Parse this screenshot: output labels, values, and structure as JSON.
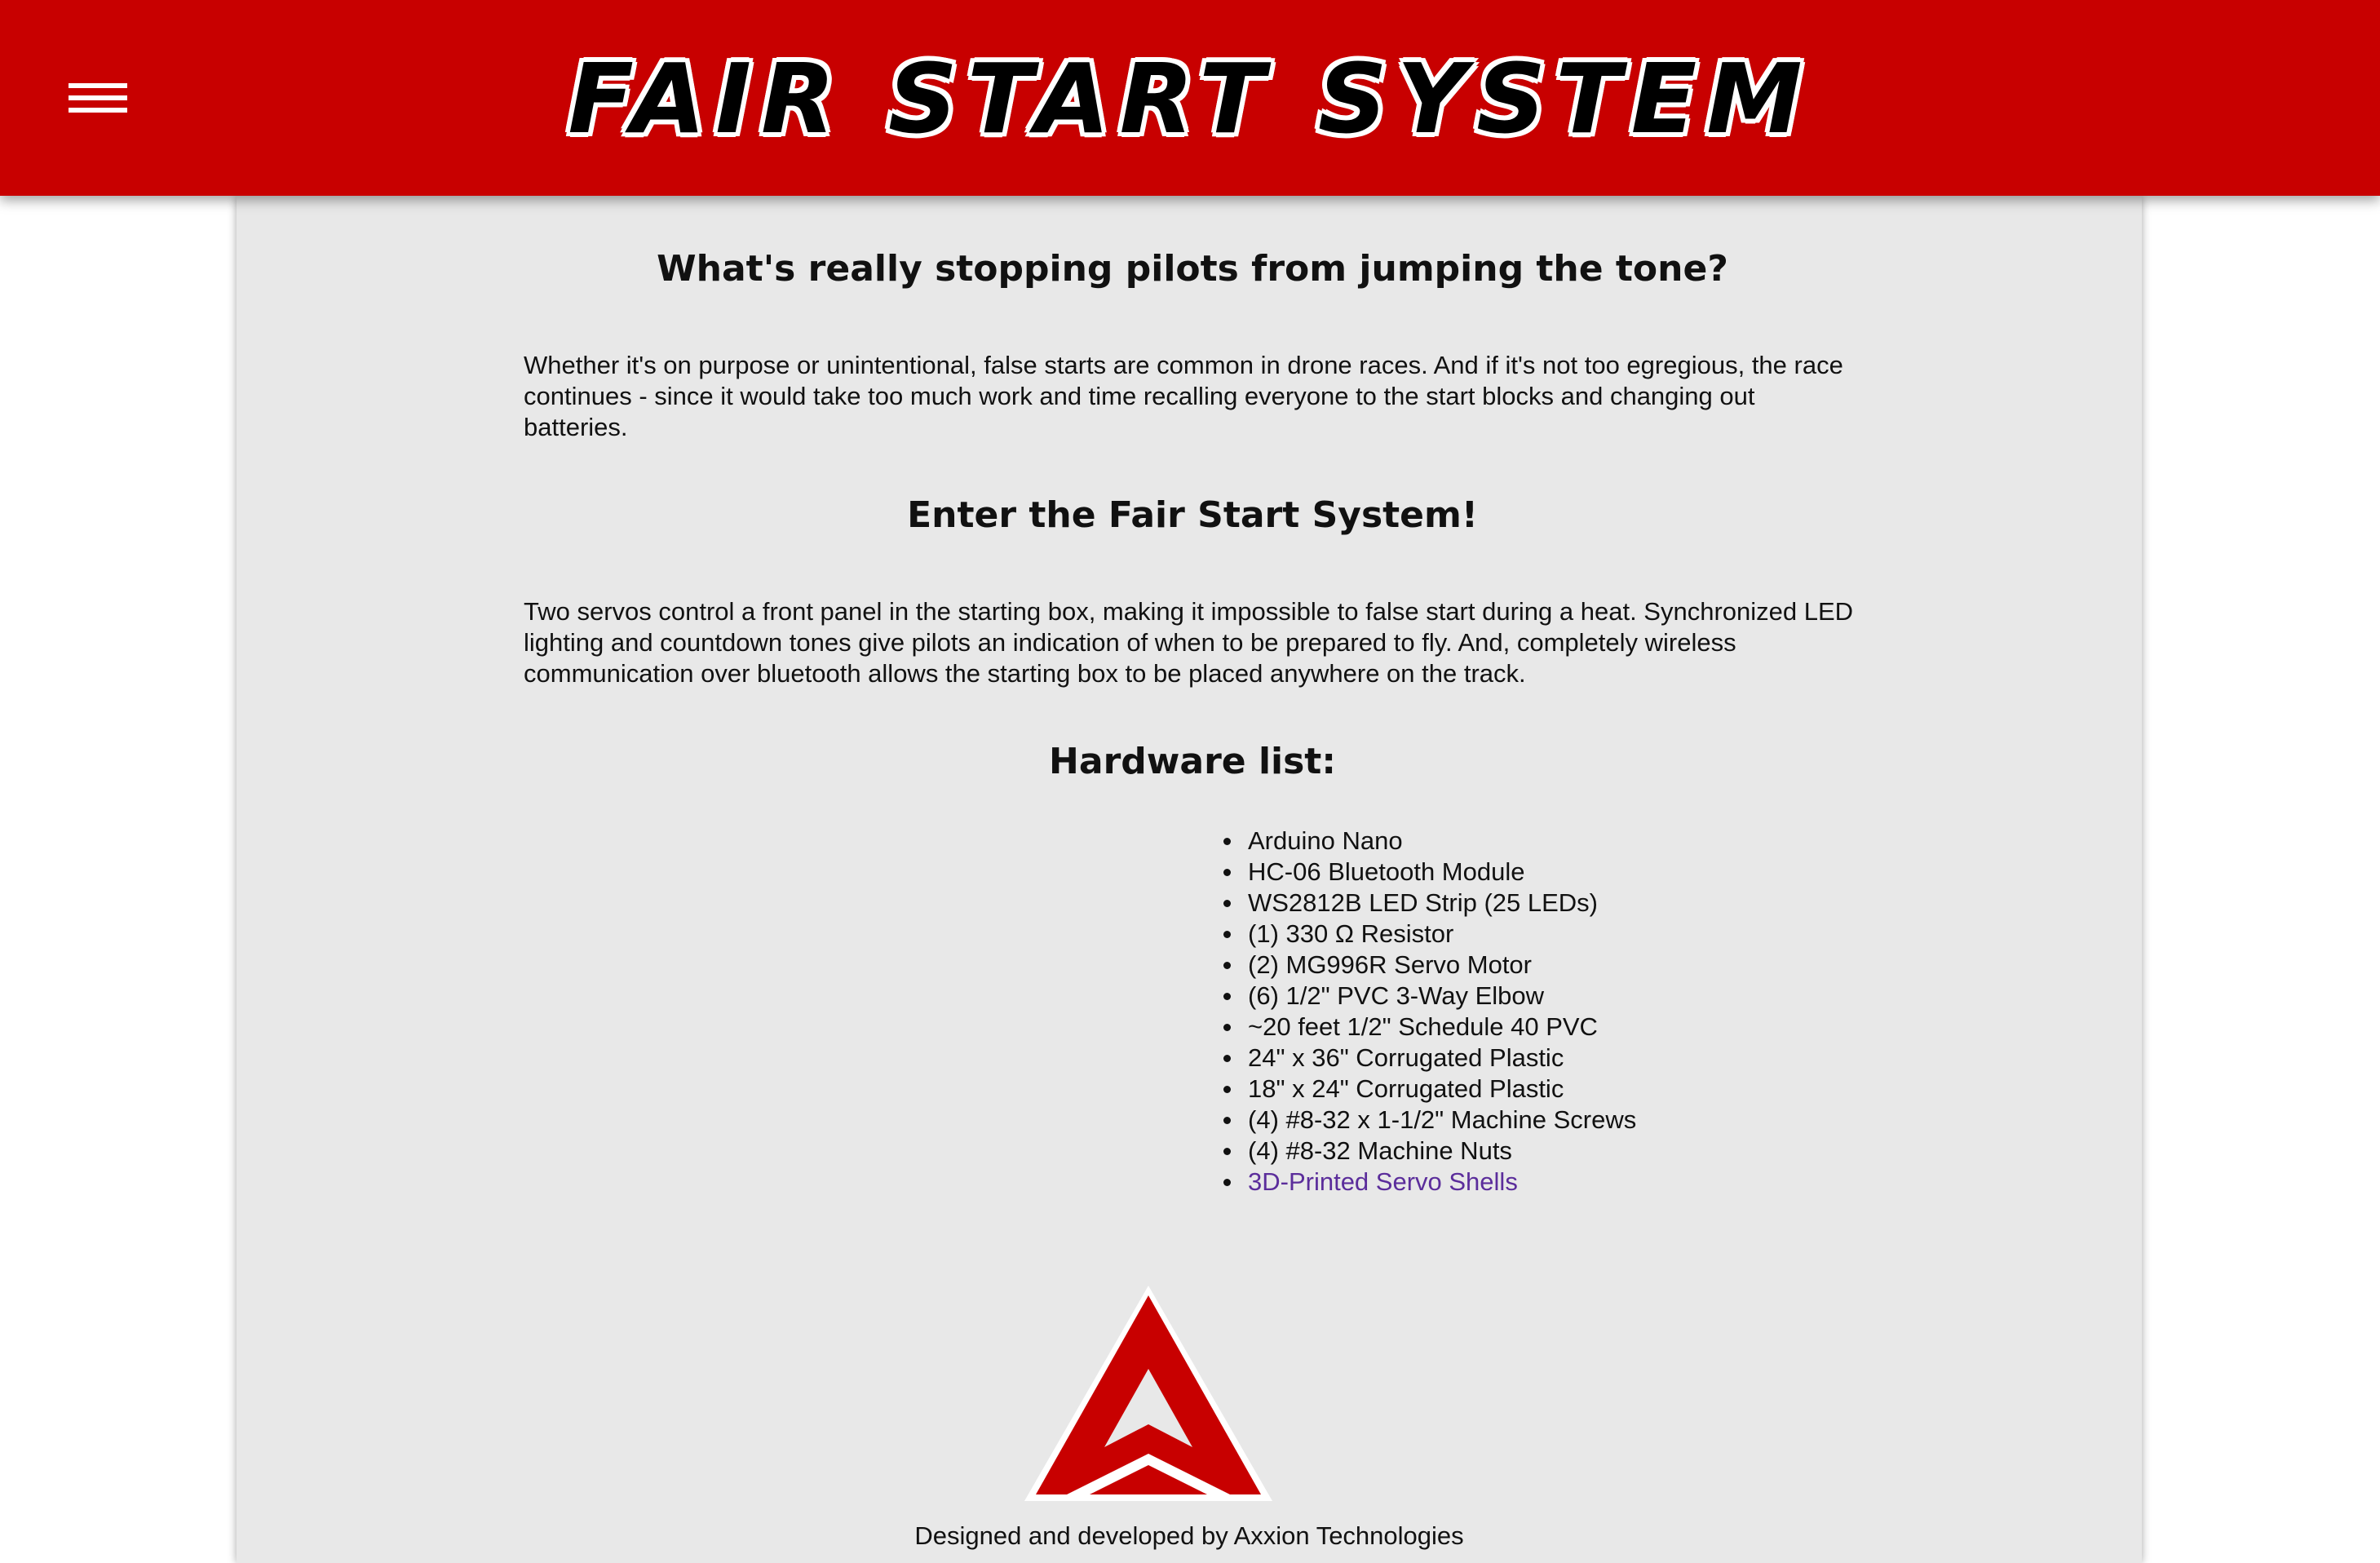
{
  "header": {
    "title": "FAIR START SYSTEM",
    "menu_icon": "hamburger-menu-icon",
    "background_color": "#c80000"
  },
  "main": {
    "heading1": "What's really stopping pilots from jumping the tone?",
    "paragraph1": "Whether it's on purpose or unintentional, false starts are common in drone races. And if it's not too egregious, the race continues - since it would take too much work and time recalling everyone to the start blocks and changing out batteries.",
    "heading2": "Enter the Fair Start System!",
    "paragraph2": "Two servos control a front panel in the starting box, making it impossible to false start during a heat. Synchronized LED lighting and countdown tones give pilots an indication of when to be prepared to fly. And, completely wireless communication over bluetooth allows the starting box to be placed anywhere on the track.",
    "heading3": "Hardware list:",
    "hardware": [
      "Arduino Nano",
      "HC-06 Bluetooth Module",
      "WS2812B LED Strip (25 LEDs)",
      "(1) 330 Ω Resistor",
      "(2) MG996R Servo Motor",
      "(6) 1/2\" PVC 3-Way Elbow",
      "~20 feet 1/2\" Schedule 40 PVC",
      "24\" x 36\" Corrugated Plastic",
      "18\" x 24\" Corrugated Plastic",
      "(4) #8-32 x 1-1/2\" Machine Screws",
      "(4) #8-32 Machine Nuts"
    ],
    "hardware_link": "3D-Printed Servo Shells",
    "link_color": "#5b2d9b"
  },
  "footer": {
    "logo_icon": "axxion-logo-icon",
    "logo_color": "#c80000",
    "credit": "Designed and developed by Axxion Technologies"
  }
}
